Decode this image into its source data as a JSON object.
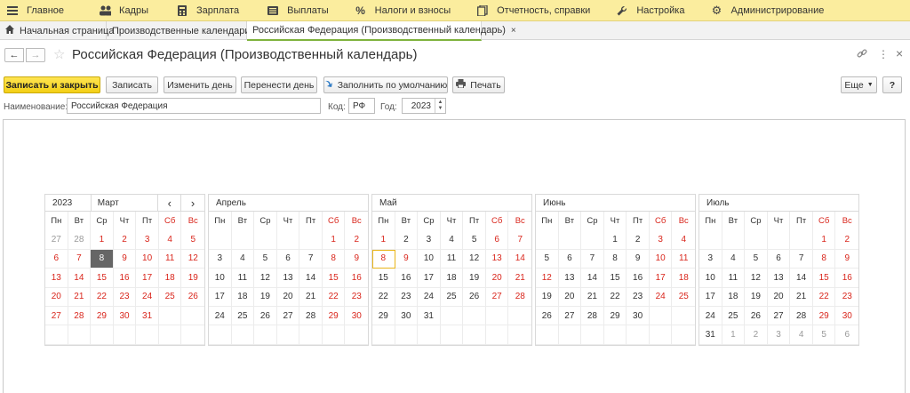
{
  "menu": [
    {
      "label": "Главное",
      "icon": "menu-icon"
    },
    {
      "label": "Кадры",
      "icon": "people-icon"
    },
    {
      "label": "Зарплата",
      "icon": "calculator-icon"
    },
    {
      "label": "Выплаты",
      "icon": "wallet-icon"
    },
    {
      "label": "Налоги и взносы",
      "icon": "percent-icon"
    },
    {
      "label": "Отчетность, справки",
      "icon": "documents-icon"
    },
    {
      "label": "Настройка",
      "icon": "wrench-icon"
    },
    {
      "label": "Администрирование",
      "icon": "gear-icon"
    }
  ],
  "tabs": [
    {
      "label": "Начальная страница",
      "icon": "home-icon"
    },
    {
      "label": "Производственные календари"
    },
    {
      "label": "Российская Федерация (Производственный календарь)",
      "close": "×"
    }
  ],
  "header": {
    "back": "←",
    "forward": "→",
    "title": "Российская Федерация (Производственный календарь)",
    "star": "☆",
    "link_icon": "link-icon",
    "more": "⋮",
    "close": "×"
  },
  "toolbar": {
    "save_close": "Записать и закрыть",
    "save": "Записать",
    "change_day": "Изменить день",
    "move_day": "Перенести день",
    "fill_default": "Заполнить по умолчанию",
    "print": "Печать",
    "more": "Еще",
    "help": "?"
  },
  "fields": {
    "name_label": "Наименование:",
    "name_value": "Российская Федерация",
    "code_label": "Код:",
    "code_value": "РФ",
    "year_label": "Год:",
    "year_value": "2023"
  },
  "calendar": {
    "year": "2023",
    "weekdays": [
      "Пн",
      "Вт",
      "Ср",
      "Чт",
      "Пт",
      "Сб",
      "Вс"
    ],
    "prev": "‹",
    "next": "›",
    "months": [
      {
        "name": "Март",
        "weeks": [
          [
            {
              "d": "27",
              "o": 1
            },
            {
              "d": "28",
              "o": 1
            },
            {
              "d": "1",
              "w": 1
            },
            {
              "d": "2",
              "w": 1
            },
            {
              "d": "3",
              "w": 1
            },
            {
              "d": "4",
              "w": 1
            },
            {
              "d": "5",
              "w": 1
            }
          ],
          [
            {
              "d": "6",
              "w": 1
            },
            {
              "d": "7",
              "w": 1
            },
            {
              "d": "8",
              "s": 1
            },
            {
              "d": "9",
              "w": 1
            },
            {
              "d": "10",
              "w": 1
            },
            {
              "d": "11",
              "w": 1
            },
            {
              "d": "12",
              "w": 1
            }
          ],
          [
            {
              "d": "13",
              "w": 1
            },
            {
              "d": "14",
              "w": 1
            },
            {
              "d": "15",
              "w": 1
            },
            {
              "d": "16",
              "w": 1
            },
            {
              "d": "17",
              "w": 1
            },
            {
              "d": "18",
              "w": 1
            },
            {
              "d": "19",
              "w": 1
            }
          ],
          [
            {
              "d": "20",
              "w": 1
            },
            {
              "d": "21",
              "w": 1
            },
            {
              "d": "22",
              "w": 1
            },
            {
              "d": "23",
              "w": 1
            },
            {
              "d": "24",
              "w": 1
            },
            {
              "d": "25",
              "w": 1
            },
            {
              "d": "26",
              "w": 1
            }
          ],
          [
            {
              "d": "27",
              "w": 1
            },
            {
              "d": "28",
              "w": 1
            },
            {
              "d": "29",
              "w": 1
            },
            {
              "d": "30",
              "w": 1
            },
            {
              "d": "31",
              "w": 1
            },
            {
              "d": ""
            },
            {
              "d": ""
            }
          ],
          [
            {
              "d": ""
            },
            {
              "d": ""
            },
            {
              "d": ""
            },
            {
              "d": ""
            },
            {
              "d": ""
            },
            {
              "d": ""
            },
            {
              "d": ""
            }
          ]
        ]
      },
      {
        "name": "Апрель",
        "weeks": [
          [
            {
              "d": ""
            },
            {
              "d": ""
            },
            {
              "d": ""
            },
            {
              "d": ""
            },
            {
              "d": ""
            },
            {
              "d": "1",
              "w": 1
            },
            {
              "d": "2",
              "w": 1
            }
          ],
          [
            {
              "d": "3"
            },
            {
              "d": "4"
            },
            {
              "d": "5"
            },
            {
              "d": "6"
            },
            {
              "d": "7"
            },
            {
              "d": "8",
              "w": 1
            },
            {
              "d": "9",
              "w": 1
            }
          ],
          [
            {
              "d": "10"
            },
            {
              "d": "11"
            },
            {
              "d": "12"
            },
            {
              "d": "13"
            },
            {
              "d": "14"
            },
            {
              "d": "15",
              "w": 1
            },
            {
              "d": "16",
              "w": 1
            }
          ],
          [
            {
              "d": "17"
            },
            {
              "d": "18"
            },
            {
              "d": "19"
            },
            {
              "d": "20"
            },
            {
              "d": "21"
            },
            {
              "d": "22",
              "w": 1
            },
            {
              "d": "23",
              "w": 1
            }
          ],
          [
            {
              "d": "24"
            },
            {
              "d": "25"
            },
            {
              "d": "26"
            },
            {
              "d": "27"
            },
            {
              "d": "28"
            },
            {
              "d": "29",
              "w": 1
            },
            {
              "d": "30",
              "w": 1
            }
          ],
          [
            {
              "d": ""
            },
            {
              "d": ""
            },
            {
              "d": ""
            },
            {
              "d": ""
            },
            {
              "d": ""
            },
            {
              "d": ""
            },
            {
              "d": ""
            }
          ]
        ]
      },
      {
        "name": "Май",
        "weeks": [
          [
            {
              "d": "1",
              "w": 1
            },
            {
              "d": "2"
            },
            {
              "d": "3"
            },
            {
              "d": "4"
            },
            {
              "d": "5"
            },
            {
              "d": "6",
              "w": 1
            },
            {
              "d": "7",
              "w": 1
            }
          ],
          [
            {
              "d": "8",
              "w": 1,
              "t": 1
            },
            {
              "d": "9",
              "w": 1
            },
            {
              "d": "10"
            },
            {
              "d": "11"
            },
            {
              "d": "12"
            },
            {
              "d": "13",
              "w": 1
            },
            {
              "d": "14",
              "w": 1
            }
          ],
          [
            {
              "d": "15"
            },
            {
              "d": "16"
            },
            {
              "d": "17"
            },
            {
              "d": "18"
            },
            {
              "d": "19"
            },
            {
              "d": "20",
              "w": 1
            },
            {
              "d": "21",
              "w": 1
            }
          ],
          [
            {
              "d": "22"
            },
            {
              "d": "23"
            },
            {
              "d": "24"
            },
            {
              "d": "25"
            },
            {
              "d": "26"
            },
            {
              "d": "27",
              "w": 1
            },
            {
              "d": "28",
              "w": 1
            }
          ],
          [
            {
              "d": "29"
            },
            {
              "d": "30"
            },
            {
              "d": "31"
            },
            {
              "d": ""
            },
            {
              "d": ""
            },
            {
              "d": ""
            },
            {
              "d": ""
            }
          ],
          [
            {
              "d": ""
            },
            {
              "d": ""
            },
            {
              "d": ""
            },
            {
              "d": ""
            },
            {
              "d": ""
            },
            {
              "d": ""
            },
            {
              "d": ""
            }
          ]
        ]
      },
      {
        "name": "Июнь",
        "weeks": [
          [
            {
              "d": ""
            },
            {
              "d": ""
            },
            {
              "d": ""
            },
            {
              "d": "1"
            },
            {
              "d": "2"
            },
            {
              "d": "3",
              "w": 1
            },
            {
              "d": "4",
              "w": 1
            }
          ],
          [
            {
              "d": "5"
            },
            {
              "d": "6"
            },
            {
              "d": "7"
            },
            {
              "d": "8"
            },
            {
              "d": "9"
            },
            {
              "d": "10",
              "w": 1
            },
            {
              "d": "11",
              "w": 1
            }
          ],
          [
            {
              "d": "12",
              "w": 1
            },
            {
              "d": "13"
            },
            {
              "d": "14"
            },
            {
              "d": "15"
            },
            {
              "d": "16"
            },
            {
              "d": "17",
              "w": 1
            },
            {
              "d": "18",
              "w": 1
            }
          ],
          [
            {
              "d": "19"
            },
            {
              "d": "20"
            },
            {
              "d": "21"
            },
            {
              "d": "22"
            },
            {
              "d": "23"
            },
            {
              "d": "24",
              "w": 1
            },
            {
              "d": "25",
              "w": 1
            }
          ],
          [
            {
              "d": "26"
            },
            {
              "d": "27"
            },
            {
              "d": "28"
            },
            {
              "d": "29"
            },
            {
              "d": "30"
            },
            {
              "d": ""
            },
            {
              "d": ""
            }
          ],
          [
            {
              "d": ""
            },
            {
              "d": ""
            },
            {
              "d": ""
            },
            {
              "d": ""
            },
            {
              "d": ""
            },
            {
              "d": ""
            },
            {
              "d": ""
            }
          ]
        ]
      },
      {
        "name": "Июль",
        "weeks": [
          [
            {
              "d": ""
            },
            {
              "d": ""
            },
            {
              "d": ""
            },
            {
              "d": ""
            },
            {
              "d": ""
            },
            {
              "d": "1",
              "w": 1
            },
            {
              "d": "2",
              "w": 1
            }
          ],
          [
            {
              "d": "3"
            },
            {
              "d": "4"
            },
            {
              "d": "5"
            },
            {
              "d": "6"
            },
            {
              "d": "7"
            },
            {
              "d": "8",
              "w": 1
            },
            {
              "d": "9",
              "w": 1
            }
          ],
          [
            {
              "d": "10"
            },
            {
              "d": "11"
            },
            {
              "d": "12"
            },
            {
              "d": "13"
            },
            {
              "d": "14"
            },
            {
              "d": "15",
              "w": 1
            },
            {
              "d": "16",
              "w": 1
            }
          ],
          [
            {
              "d": "17"
            },
            {
              "d": "18"
            },
            {
              "d": "19"
            },
            {
              "d": "20"
            },
            {
              "d": "21"
            },
            {
              "d": "22",
              "w": 1
            },
            {
              "d": "23",
              "w": 1
            }
          ],
          [
            {
              "d": "24"
            },
            {
              "d": "25"
            },
            {
              "d": "26"
            },
            {
              "d": "27"
            },
            {
              "d": "28"
            },
            {
              "d": "29",
              "w": 1
            },
            {
              "d": "30",
              "w": 1
            }
          ],
          [
            {
              "d": "31"
            },
            {
              "d": "1",
              "o": 1
            },
            {
              "d": "2",
              "o": 1
            },
            {
              "d": "3",
              "o": 1
            },
            {
              "d": "4",
              "o": 1
            },
            {
              "d": "5",
              "o": 1
            },
            {
              "d": "6",
              "o": 1
            }
          ]
        ]
      }
    ]
  },
  "colors": {
    "menubar": "#fbed9e",
    "primary_button": "#f3cf16",
    "weekend": "#d9261c",
    "selected_day": "#666666",
    "today_outline": "#e9b51a",
    "active_tab_underline": "#7fb33d"
  }
}
